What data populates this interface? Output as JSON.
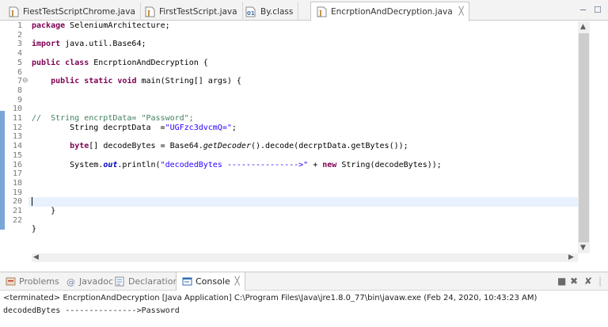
{
  "editor_tabs": [
    {
      "label": "FiestTestScriptChrome.java",
      "icon": "java-file-icon",
      "active": false
    },
    {
      "label": "FirstTestScript.java",
      "icon": "java-file-icon",
      "active": false
    },
    {
      "label": "By.class",
      "icon": "class-file-icon",
      "active": false
    },
    {
      "label": "EncrptionAndDecryption.java",
      "icon": "java-file-icon",
      "active": true,
      "close": "╳"
    }
  ],
  "window_controls": {
    "minimize": "−",
    "maximize": "☐"
  },
  "line_numbers": [
    "1",
    "2",
    "3",
    "4",
    "5",
    "6",
    "7",
    "8",
    "9",
    "10",
    "11",
    "12",
    "13",
    "14",
    "15",
    "16",
    "17",
    "18",
    "19",
    "20",
    "21",
    "22"
  ],
  "fold_marker": "⊖",
  "code": {
    "l1_kw": "package",
    "l1_rest": " SeleniumArchitecture;",
    "l3_kw": "import",
    "l3_rest": " java.util.Base64;",
    "l5_kw1": "public",
    "l5_kw2": "class",
    "l5_rest": " EncrptionAndDecryption {",
    "l7_kw1": "public",
    "l7_kw2": "static",
    "l7_kw3": "void",
    "l7_rest": " main(String[] args) {",
    "l10_comment": "//  String encrptData= \"Password\";",
    "l11_pre": "        String decrptData  =",
    "l11_str": "\"UGFzc3dvcmQ=\"",
    "l11_post": ";",
    "l13_kw": "byte",
    "l13_mid": "[] decodeBytes = Base64.",
    "l13_itl": "getDecoder",
    "l13_post": "().decode(decrptData.getBytes());",
    "l15_pre": "        System.",
    "l15_fld": "out",
    "l15_mid": ".println(",
    "l15_str": "\"decodedBytes --------------->\"",
    "l15_mid2": " + ",
    "l15_kw": "new",
    "l15_post": " String(decodeBytes));",
    "l20": "    }",
    "l22": "}"
  },
  "panel_tabs": [
    {
      "label": "Problems",
      "icon": "problems-icon",
      "active": false
    },
    {
      "label": "Javadoc",
      "icon": "javadoc-icon",
      "active": false
    },
    {
      "label": "Declaration",
      "icon": "declaration-icon",
      "active": false
    },
    {
      "label": "Console",
      "icon": "console-icon",
      "active": true,
      "close": "╳"
    }
  ],
  "console": {
    "status": "<terminated> EncrptionAndDecryption [Java Application] C:\\Program Files\\Java\\jre1.8.0_77\\bin\\javaw.exe (Feb 24, 2020, 10:43:23 AM)",
    "output": "decodedBytes --------------->Password"
  },
  "colors": {
    "keyword": "#7f0055",
    "string": "#2a00ff",
    "comment": "#3f7f5f",
    "field": "#0000c0",
    "current_line": "#e8f2fe"
  }
}
